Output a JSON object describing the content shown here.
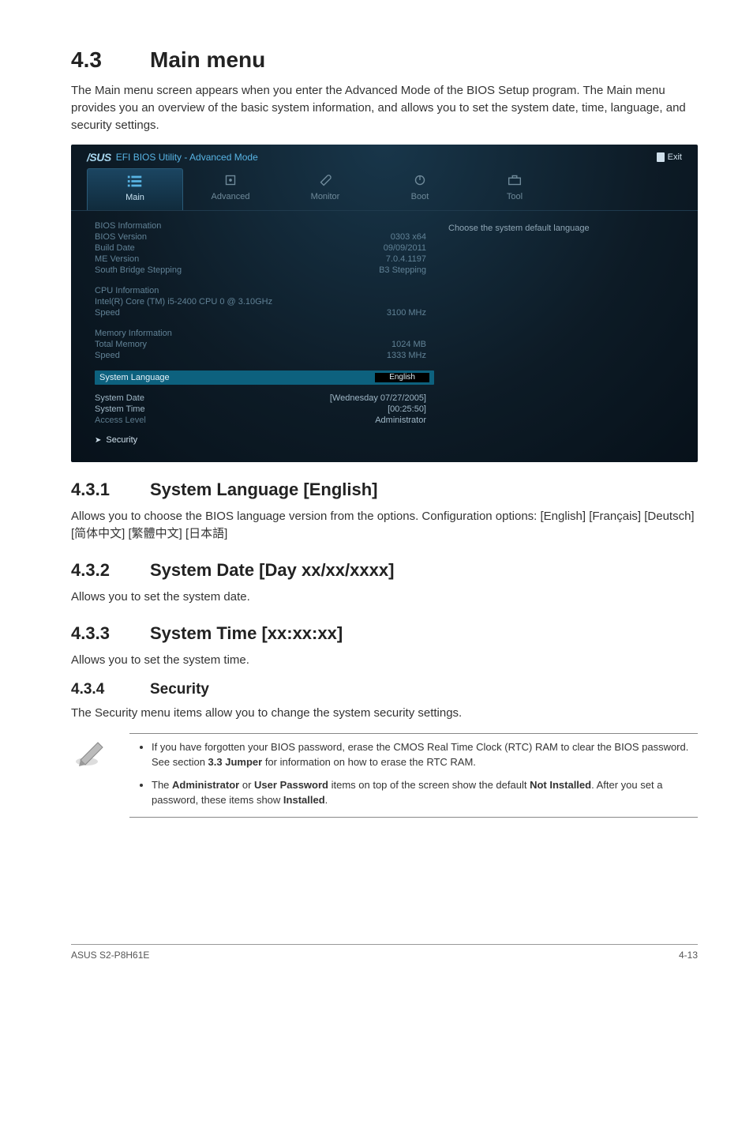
{
  "section": {
    "number": "4.3",
    "title": "Main menu",
    "intro": "The Main menu screen appears when you enter the Advanced Mode of the BIOS Setup program. The Main menu provides you an overview of the basic system information, and allows you to set the system date, time, language, and security settings."
  },
  "bios": {
    "title": "EFI BIOS Utility - Advanced Mode",
    "exit": "Exit",
    "tabs": [
      {
        "label": "Main",
        "active": true
      },
      {
        "label": "Advanced",
        "active": false
      },
      {
        "label": "Monitor",
        "active": false
      },
      {
        "label": "Boot",
        "active": false
      },
      {
        "label": "Tool",
        "active": false
      }
    ],
    "hint": "Choose the system default language",
    "groups": {
      "bios_information": {
        "header": "BIOS Information",
        "rows": [
          {
            "label": "BIOS Version",
            "value": "0303 x64"
          },
          {
            "label": "Build Date",
            "value": "09/09/2011"
          },
          {
            "label": "ME Version",
            "value": "7.0.4.1197"
          },
          {
            "label": "South Bridge Stepping",
            "value": "B3 Stepping"
          }
        ]
      },
      "cpu_information": {
        "header": "CPU Information",
        "cpu_line": "Intel(R) Core (TM) i5-2400 CPU 0 @ 3.10GHz",
        "rows": [
          {
            "label": "Speed",
            "value": "3100 MHz"
          }
        ]
      },
      "memory_information": {
        "header": "Memory Information",
        "rows": [
          {
            "label": "Total Memory",
            "value": "1024 MB"
          },
          {
            "label": "Speed",
            "value": "1333 MHz"
          }
        ]
      }
    },
    "system_language": {
      "label": "System Language",
      "value": "English"
    },
    "config": [
      {
        "label": "System Date",
        "value": "[Wednesday 07/27/2005]"
      },
      {
        "label": "System Time",
        "value": "[00:25:50]"
      },
      {
        "label": "Access Level",
        "value": "Administrator"
      }
    ],
    "security": "Security"
  },
  "subsections": {
    "s431": {
      "num": "4.3.1",
      "title": "System Language [English]",
      "body": "Allows you to choose the BIOS language version from the options. Configuration options: [English] [Français] [Deutsch] [简体中文] [繁體中文] [日本語]"
    },
    "s432": {
      "num": "4.3.2",
      "title": "System Date [Day xx/xx/xxxx]",
      "body": "Allows you to set the system date."
    },
    "s433": {
      "num": "4.3.3",
      "title": "System Time [xx:xx:xx]",
      "body": "Allows you to set the system time."
    },
    "s434": {
      "num": "4.3.4",
      "title": "Security",
      "body": "The Security menu items allow you to change the system security settings."
    }
  },
  "notes": {
    "n1_pre": "If you have forgotten your BIOS password, erase the CMOS Real Time Clock (RTC) RAM to clear the BIOS password. See section ",
    "n1_bold": "3.3 Jumper",
    "n1_post": " for information on how to erase the RTC RAM.",
    "n2_pre": "The ",
    "n2_b1": "Administrator",
    "n2_mid1": " or ",
    "n2_b2": "User Password",
    "n2_mid2": " items on top of the screen show the default ",
    "n2_b3": "Not Installed",
    "n2_mid3": ". After you set a password, these items show ",
    "n2_b4": "Installed",
    "n2_post": "."
  },
  "footer": {
    "left": "ASUS S2-P8H61E",
    "right": "4-13"
  }
}
